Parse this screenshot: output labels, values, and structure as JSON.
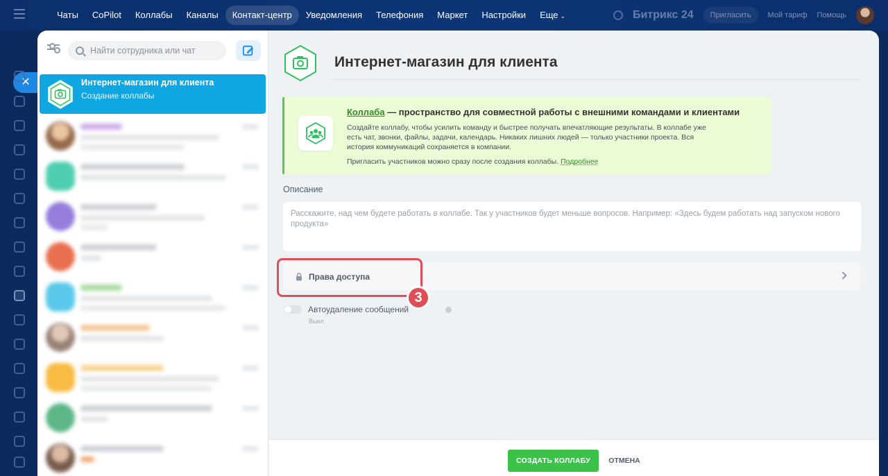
{
  "nav": {
    "items": [
      {
        "label": "Чаты"
      },
      {
        "label": "CoPilot"
      },
      {
        "label": "Коллабы"
      },
      {
        "label": "Каналы"
      },
      {
        "label": "Контакт-центр"
      },
      {
        "label": "Уведомления"
      },
      {
        "label": "Телефония"
      },
      {
        "label": "Маркет"
      },
      {
        "label": "Настройки"
      },
      {
        "label": "Еще"
      }
    ],
    "active_index": 4,
    "brand": "Битрикс 24",
    "invite": "Пригласить",
    "tariff": "Мой тариф",
    "help": "Помощь"
  },
  "chatlist": {
    "search_placeholder": "Найти сотрудника или чат",
    "active_chat": {
      "title": "Интернет-магазин для клиента",
      "subtitle": "Создание коллабы"
    }
  },
  "form": {
    "title": "Интернет-магазин для клиента",
    "promo": {
      "head_link": "Коллаба",
      "head_rest": " — пространство для совместной работы с внешними командами и клиентами",
      "text": "Создайте коллабу, чтобы усилить команду и быстрее получать впечатляющие результаты. В коллабе уже есть чат, звонки, файлы, задачи, календарь. Никаких лишних людей — только участники проекта. Вся история коммуникаций сохраняется в компании.",
      "invite": "Пригласить участников можно сразу после создания коллабы.",
      "more": "Подробнее"
    },
    "description_label": "Описание",
    "description_placeholder": "Расскажите, над чем будете работать в коллабе. Так у участников будет меньше вопросов. Например: «Здесь будем работать над запуском нового продукта»",
    "access_label": "Права доступа",
    "autodelete_label": "Автоудаление сообщений",
    "autodelete_state": "Выкл",
    "step_number": "3",
    "create_button": "СОЗДАТЬ КОЛЛАБУ",
    "cancel_button": "ОТМЕНА"
  },
  "colors": {
    "accent_blue": "#0fa6e1",
    "collab_green": "#3bc249",
    "highlight_red": "#e04e55"
  }
}
